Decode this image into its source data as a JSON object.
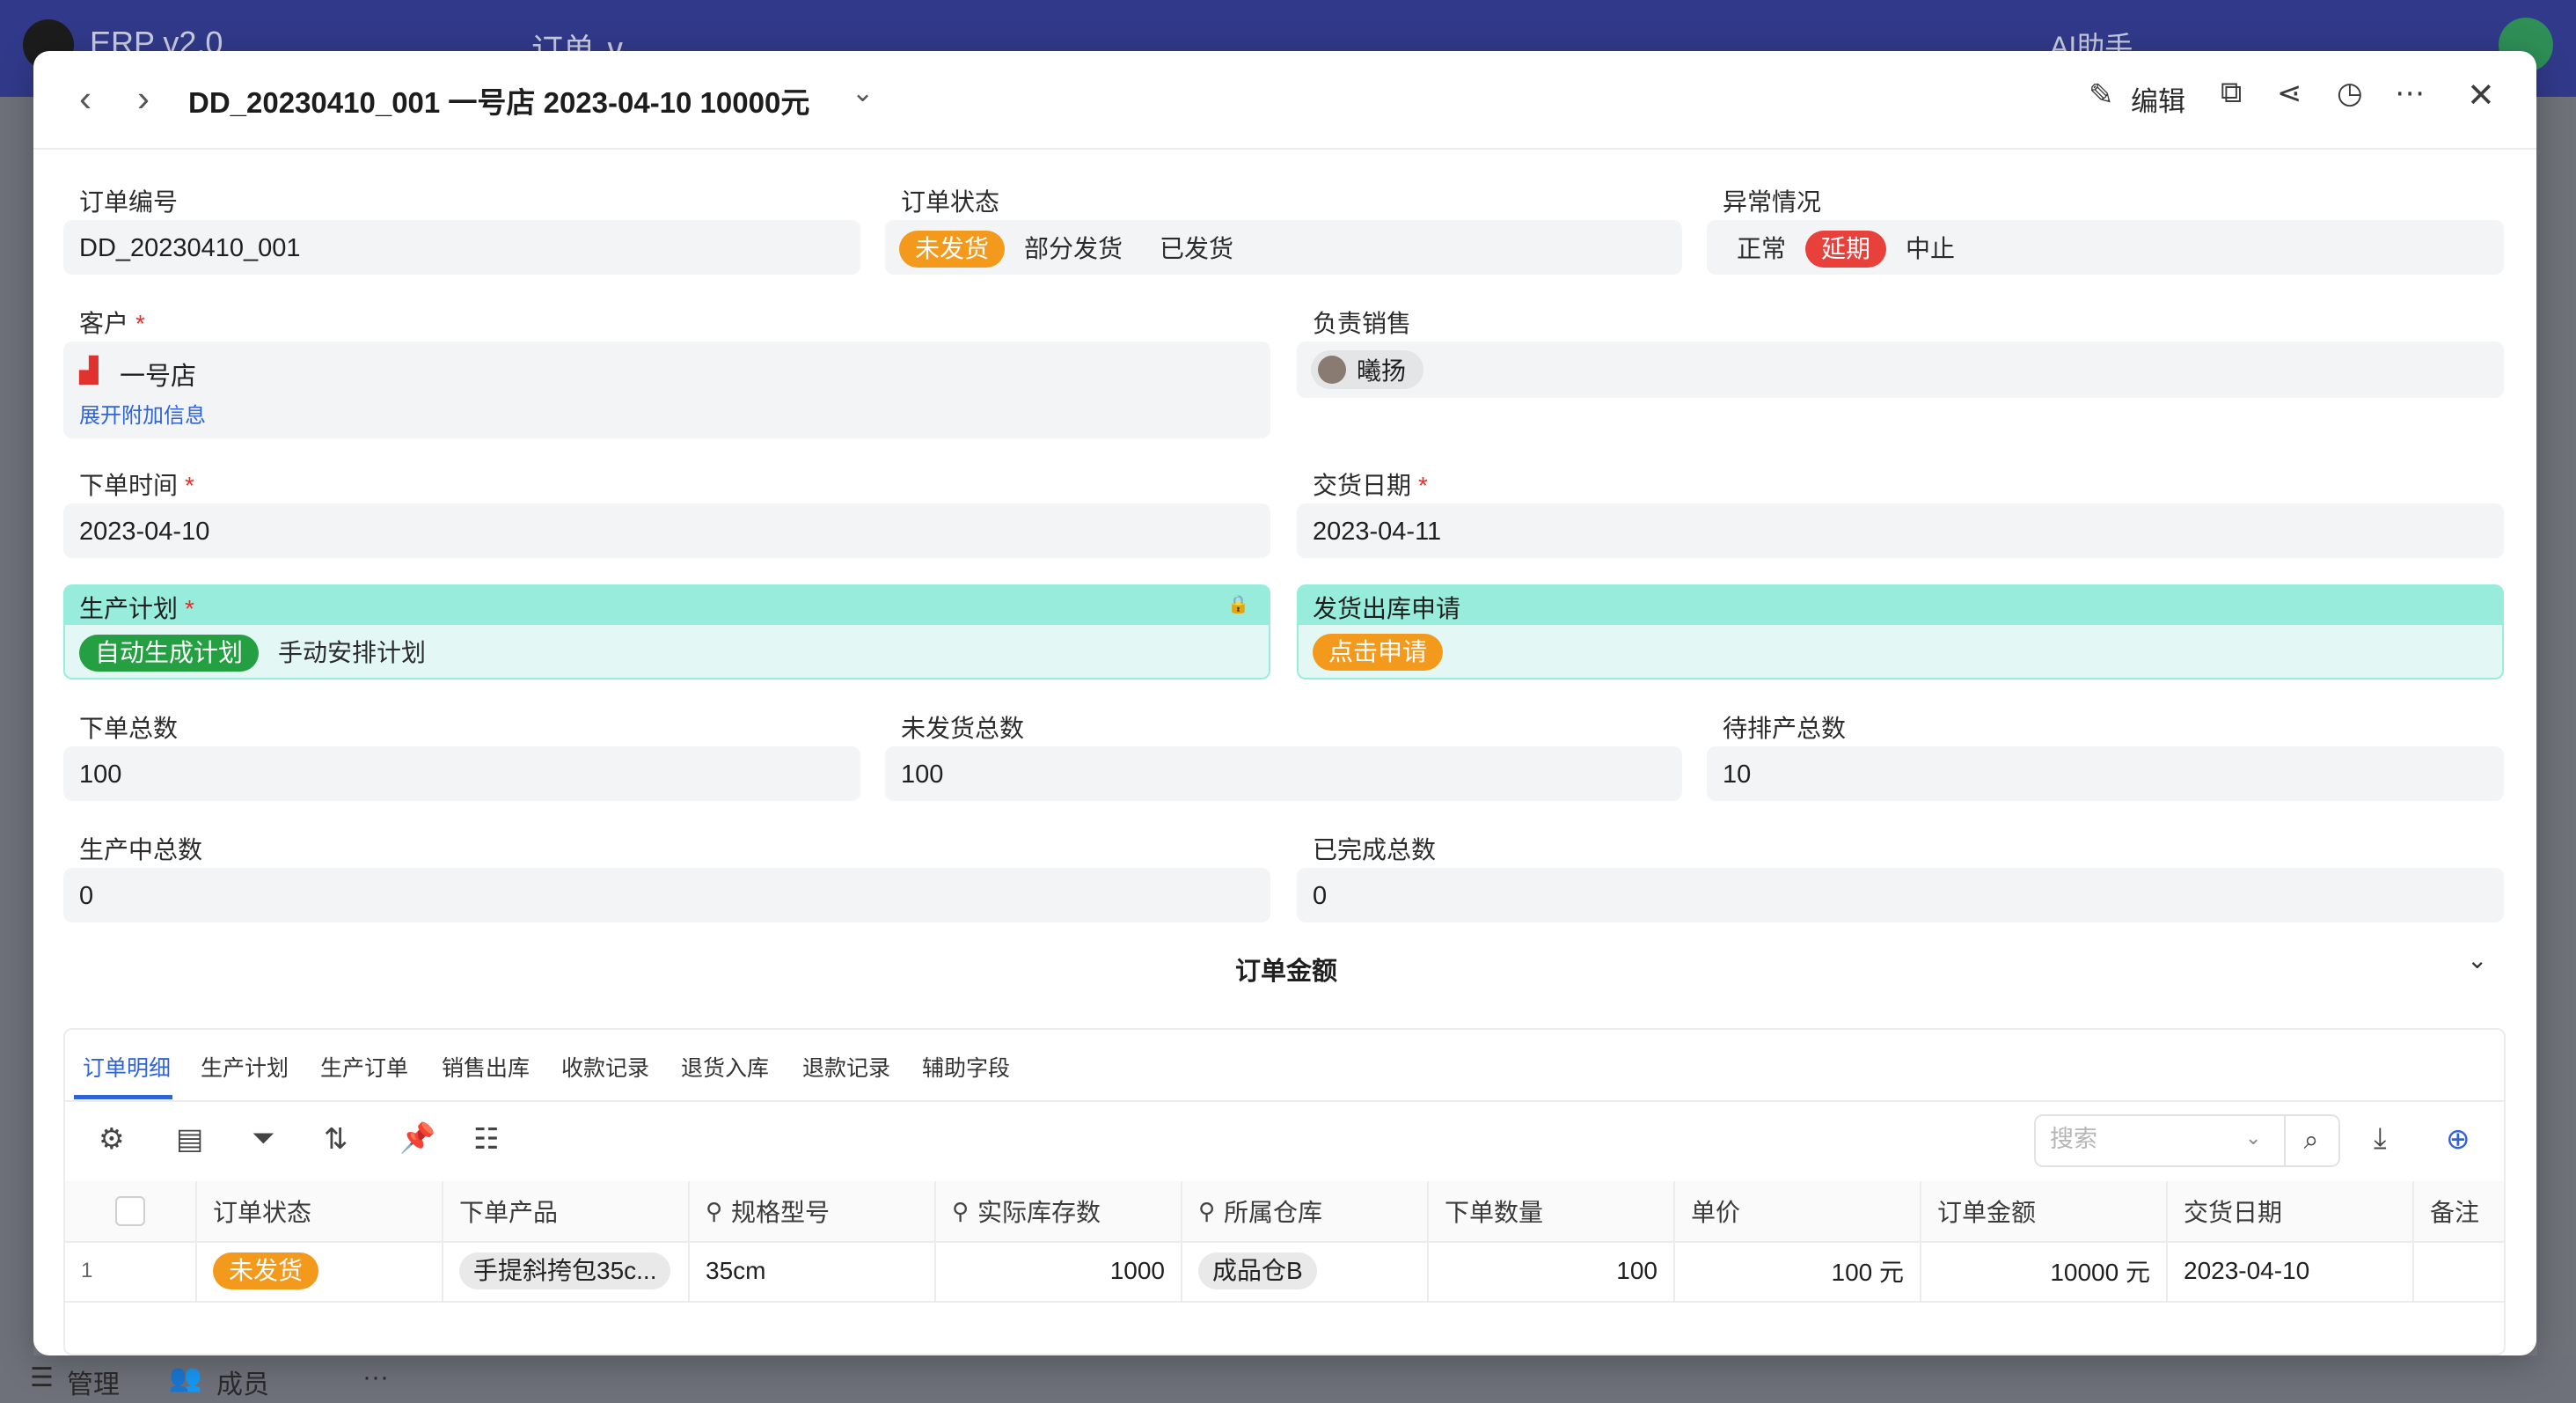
{
  "app": {
    "name": "ERP v2.0",
    "module_tab": "订单 ∨",
    "ai_helper": "AI助手",
    "footer_manage": "管理",
    "footer_members": "成员",
    "footer_more": "···"
  },
  "header": {
    "title": "DD_20230410_001 一号店 2023-04-10 10000元",
    "edit_label": "编辑"
  },
  "form": {
    "order_no": {
      "label": "订单编号",
      "value": "DD_20230410_001"
    },
    "order_status": {
      "label": "订单状态",
      "options": [
        "未发货",
        "部分发货",
        "已发货"
      ],
      "selected": "未发货"
    },
    "exception": {
      "label": "异常情况",
      "options": [
        "正常",
        "延期",
        "中止"
      ],
      "selected": "延期"
    },
    "customer": {
      "label": "客户",
      "required": "*",
      "value": "一号店",
      "expand_link": "展开附加信息"
    },
    "sales_rep": {
      "label": "负责销售",
      "value": "曦扬"
    },
    "order_time": {
      "label": "下单时间",
      "required": "*",
      "value": "2023-04-10"
    },
    "delivery_date": {
      "label": "交货日期",
      "required": "*",
      "value": "2023-04-11"
    },
    "production_plan": {
      "label": "生产计划",
      "required": "*",
      "options": [
        "自动生成计划",
        "手动安排计划"
      ],
      "selected": "自动生成计划"
    },
    "shipment_request": {
      "label": "发货出库申请",
      "button": "点击申请"
    },
    "total_ordered": {
      "label": "下单总数",
      "value": "100"
    },
    "total_unshipped": {
      "label": "未发货总数",
      "value": "100"
    },
    "total_pending": {
      "label": "待排产总数",
      "value": "10"
    },
    "total_in_production": {
      "label": "生产中总数",
      "value": "0"
    },
    "total_completed": {
      "label": "已完成总数",
      "value": "0"
    },
    "amount_section": "订单金额"
  },
  "tabs": [
    "订单明细",
    "生产计划",
    "生产订单",
    "销售出库",
    "收款记录",
    "退货入库",
    "退款记录",
    "辅助字段"
  ],
  "search": {
    "placeholder": "搜索"
  },
  "table": {
    "columns": [
      "订单状态",
      "下单产品",
      "规格型号",
      "实际库存数",
      "所属仓库",
      "下单数量",
      "单价",
      "订单金额",
      "交货日期",
      "备注"
    ],
    "rows": [
      {
        "index": "1",
        "status": "未发货",
        "product": "手提斜挎包35c...",
        "spec": "35cm",
        "stock": "1000",
        "warehouse": "成品仓B",
        "qty": "100",
        "unit_price": "100 元",
        "amount": "10000 元",
        "delivery": "2023-04-10",
        "note": ""
      }
    ]
  },
  "colors": {
    "app_bar": "#313a8a",
    "accent_blue": "#2f63d8",
    "orange": "#f39a1c",
    "red": "#e8403b",
    "green": "#24a043",
    "teal": "#98ecdc"
  }
}
